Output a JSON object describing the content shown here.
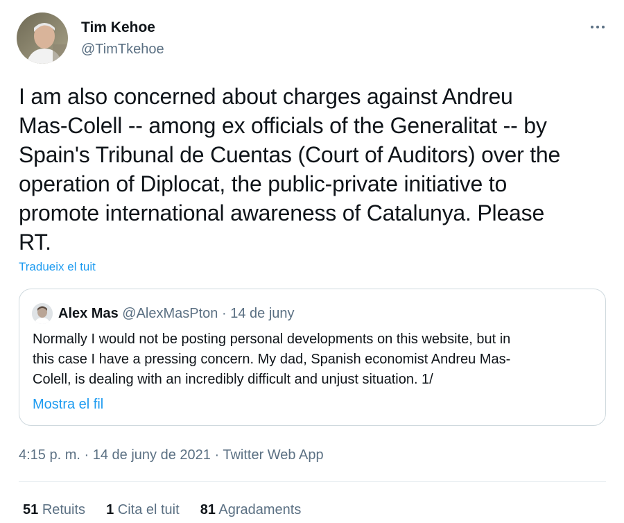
{
  "author": {
    "name": "Tim Kehoe",
    "handle": "@TimTkehoe"
  },
  "tweet": {
    "text": "I am also concerned about charges against Andreu\nMas-Colell -- among ex officials of the Generalitat -- by\nSpain's Tribunal de Cuentas (Court of Auditors) over the\noperation of Diplocat, the public-private initiative to\npromote international awareness of Catalunya. Please\nRT.",
    "translate_label": "Tradueix el tuit"
  },
  "quote": {
    "name": "Alex Mas",
    "handle": "@AlexMasPton",
    "separator": "·",
    "date": "14 de juny",
    "text": "Normally I would not be posting personal developments on this website, but in\nthis case I have a pressing concern. My dad, Spanish economist Andreu Mas-\nColell, is dealing with an incredibly difficult and unjust situation.  1/",
    "show_thread_label": "Mostra el fil"
  },
  "meta": {
    "time": "4:15 p. m.",
    "separator": "·",
    "date": "14 de juny de 2021",
    "source": "Twitter Web App"
  },
  "stats": {
    "retweets_count": "51",
    "retweets_label": "Retuits",
    "quotes_count": "1",
    "quotes_label": "Cita el tuit",
    "likes_count": "81",
    "likes_label": "Agradaments"
  },
  "colors": {
    "link": "#1d9bf0",
    "secondary_text": "#5b7083",
    "border": "#cfd9de"
  },
  "icons": {
    "more": "more-horizontal-icon"
  }
}
